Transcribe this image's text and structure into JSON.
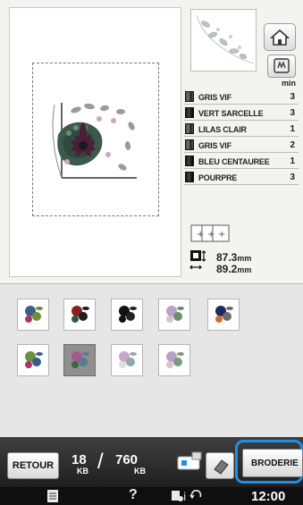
{
  "colors": {
    "background": "#f3f3f1",
    "bottom_bar": "#2e2e2e",
    "status_bar": "#0f0f0f",
    "highlight_ring": "#1e8fe8",
    "selected_tile": "#8f8f8f"
  },
  "color_list": {
    "time_unit": "min",
    "items": [
      {
        "name": "GRIS VIF",
        "minutes": "3"
      },
      {
        "name": "VERT SARCELLE",
        "minutes": "3"
      },
      {
        "name": "LILAS CLAIR",
        "minutes": "1"
      },
      {
        "name": "GRIS VIF",
        "minutes": "2"
      },
      {
        "name": "BLEU CENTAUREE",
        "minutes": "1"
      },
      {
        "name": "POURPRE",
        "minutes": "3"
      }
    ]
  },
  "design_size": {
    "width": "87.3",
    "height": "89.2",
    "unit": "mm"
  },
  "pattern_selection": {
    "selected_index": 6,
    "tile_icons": [
      "floral-pattern-icon",
      "floral-pattern-icon",
      "floral-pattern-icon",
      "floral-pattern-icon",
      "floral-pattern-icon",
      "floral-pattern-icon",
      "floral-pattern-icon",
      "floral-pattern-icon",
      "floral-pattern-icon"
    ]
  },
  "bottom_bar": {
    "back_label": "RETOUR",
    "memory_used": "18",
    "memory_used_unit": "KB",
    "memory_total": "760",
    "memory_total_unit": "KB",
    "embroidery_label": "BRODERIE"
  },
  "status_bar": {
    "help_label": "?",
    "time": "12:00"
  }
}
